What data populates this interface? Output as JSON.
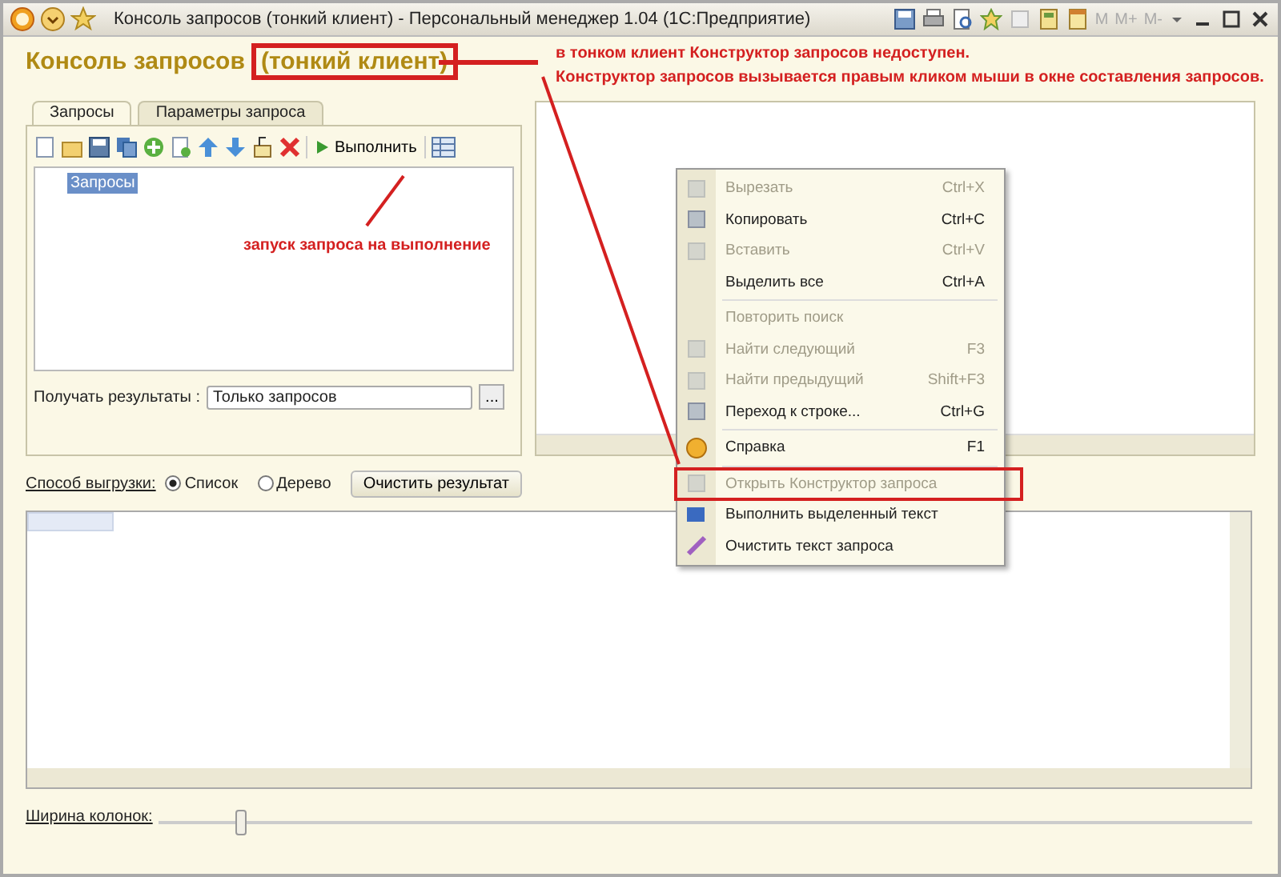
{
  "window": {
    "title": "Консоль запросов (тонкий клиент) - Персональный менеджер 1.04  (1С:Предприятие)",
    "memory_buttons": [
      "M",
      "M+",
      "M-"
    ]
  },
  "header": {
    "title": "Консоль запросов",
    "boxed_title": "(тонкий клиент)"
  },
  "notes": [
    "в тонком клиент Конструктор запросов недоступен.",
    "Конструктор запросов вызывается правым кликом мыши в окне составления запросов.",
    "запуск запроса на выполнение"
  ],
  "tabs": [
    {
      "label": "Запросы",
      "selected": true
    },
    {
      "label": "Параметры запроса",
      "selected": false
    }
  ],
  "toolbar": {
    "run_button": "Выполнить"
  },
  "tree": {
    "items": [
      {
        "label": "Запросы",
        "selected": true
      }
    ]
  },
  "results_field": {
    "label": "Получать результаты :",
    "value": "Только запросов",
    "button": "..."
  },
  "export": {
    "label": "Способ выгрузки:",
    "options": [
      {
        "label": "Список",
        "selected": true
      },
      {
        "label": "Дерево",
        "selected": false
      }
    ],
    "clear_button": "Очистить результат"
  },
  "column_width": {
    "label": "Ширина колонок:",
    "level": 0.07
  },
  "menu": {
    "groups": [
      {
        "items": [
          {
            "label": "Вырезать",
            "shortcut": "Ctrl+X",
            "disabled": true,
            "annotated": false
          },
          {
            "label": "Копировать",
            "shortcut": "Ctrl+C",
            "disabled": false,
            "annotated": false
          },
          {
            "label": "Вставить",
            "shortcut": "Ctrl+V",
            "disabled": true,
            "annotated": false
          },
          {
            "label": "Выделить все",
            "shortcut": "Ctrl+A",
            "disabled": false,
            "annotated": false
          }
        ]
      },
      {
        "items": [
          {
            "label": "Повторить поиск",
            "disabled": true,
            "annotated": false
          },
          {
            "label": "Найти следующий",
            "shortcut": "F3",
            "disabled": true,
            "annotated": false
          },
          {
            "label": "Найти предыдущий",
            "shortcut": "Shift+F3",
            "disabled": true,
            "annotated": false
          },
          {
            "label": "Переход к строке...",
            "shortcut": "Ctrl+G",
            "disabled": false,
            "annotated": false
          }
        ]
      },
      {
        "items": [
          {
            "label": "Справка",
            "shortcut": "F1",
            "disabled": false,
            "annotated": false
          }
        ]
      },
      {
        "items": [
          {
            "label": "Открыть Конструктор запроса",
            "disabled": true,
            "annotated": true
          },
          {
            "label": "Выполнить выделенный текст",
            "disabled": false,
            "annotated": false
          },
          {
            "label": "Очистить текст запроса",
            "disabled": false,
            "annotated": false
          }
        ]
      }
    ]
  }
}
